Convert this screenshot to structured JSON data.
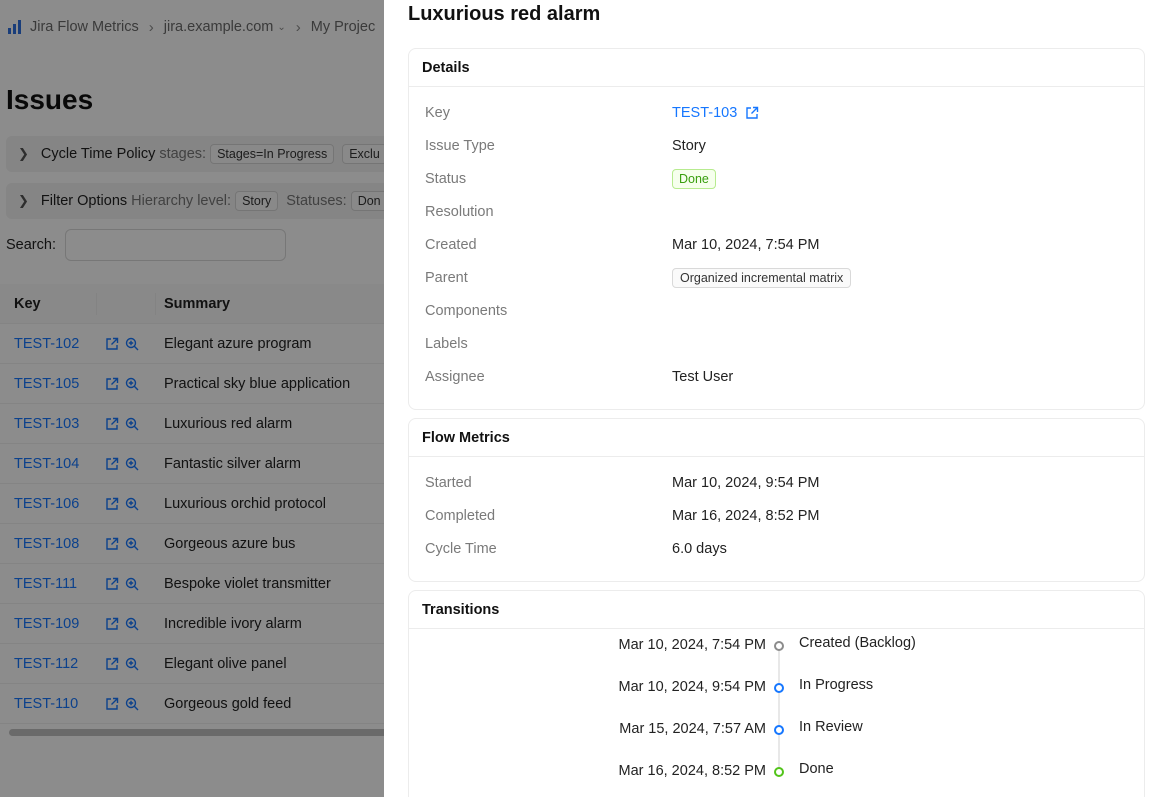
{
  "breadcrumb": {
    "app": "Jira Flow Metrics",
    "domain": "jira.example.com",
    "project": "My Projec"
  },
  "page": {
    "title": "Issues",
    "cycle_policy": {
      "title": "Cycle Time Policy",
      "sub": "stages:",
      "tags": [
        "Stages=In Progress",
        "Exclu"
      ]
    },
    "filter_options": {
      "title": "Filter Options",
      "sub1": "Hierarchy level:",
      "tag1": "Story",
      "sub2": "Statuses:",
      "tag2": "Don"
    },
    "search": {
      "label": "Search",
      "colon": ":",
      "value": ""
    }
  },
  "table": {
    "headers": {
      "key": "Key",
      "summary": "Summary"
    },
    "rows": [
      {
        "key": "TEST-102",
        "summary": "Elegant azure program"
      },
      {
        "key": "TEST-105",
        "summary": "Practical sky blue application"
      },
      {
        "key": "TEST-103",
        "summary": "Luxurious red alarm"
      },
      {
        "key": "TEST-104",
        "summary": "Fantastic silver alarm"
      },
      {
        "key": "TEST-106",
        "summary": "Luxurious orchid protocol"
      },
      {
        "key": "TEST-108",
        "summary": "Gorgeous azure bus"
      },
      {
        "key": "TEST-111",
        "summary": "Bespoke violet transmitter"
      },
      {
        "key": "TEST-109",
        "summary": "Incredible ivory alarm"
      },
      {
        "key": "TEST-112",
        "summary": "Elegant olive panel"
      },
      {
        "key": "TEST-110",
        "summary": "Gorgeous gold feed"
      }
    ]
  },
  "drawer": {
    "title": "Luxurious red alarm",
    "details": {
      "heading": "Details",
      "rows": [
        {
          "label": "Key",
          "value": "TEST-103"
        },
        {
          "label": "Issue Type",
          "value": "Story"
        },
        {
          "label": "Status",
          "value": "Done"
        },
        {
          "label": "Resolution",
          "value": ""
        },
        {
          "label": "Created",
          "value": "Mar 10, 2024, 7:54 PM"
        },
        {
          "label": "Parent",
          "value": "Organized incremental matrix"
        },
        {
          "label": "Components",
          "value": ""
        },
        {
          "label": "Labels",
          "value": ""
        },
        {
          "label": "Assignee",
          "value": "Test User"
        }
      ]
    },
    "flow_metrics": {
      "heading": "Flow Metrics",
      "rows": [
        {
          "label": "Started",
          "value": "Mar 10, 2024, 9:54 PM"
        },
        {
          "label": "Completed",
          "value": "Mar 16, 2024, 8:52 PM"
        },
        {
          "label": "Cycle Time",
          "value": "6.0 days"
        }
      ]
    },
    "transitions": {
      "heading": "Transitions",
      "items": [
        {
          "date": "Mar 10, 2024, 7:54 PM",
          "label": "Created (Backlog)",
          "color": "#8c8c8c"
        },
        {
          "date": "Mar 10, 2024, 9:54 PM",
          "label": "In Progress",
          "color": "#1677ff"
        },
        {
          "date": "Mar 15, 2024, 7:57 AM",
          "label": "In Review",
          "color": "#1677ff"
        },
        {
          "date": "Mar 16, 2024, 8:52 PM",
          "label": "Done",
          "color": "#52c41a"
        }
      ]
    }
  },
  "colors": {
    "link": "#1677ff",
    "done": "#389e0d",
    "overlay": "rgba(0,0,0,0.45)"
  },
  "icons": {
    "logo": "bar-chart-logo-icon",
    "edit": "external-link-icon",
    "zoom": "zoom-in-icon",
    "caret": "chevron-right-icon"
  }
}
